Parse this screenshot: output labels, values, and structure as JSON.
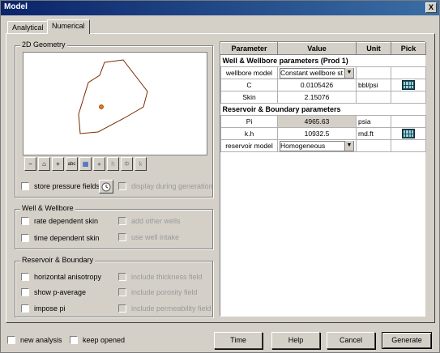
{
  "window": {
    "title": "Model",
    "close_label": "X"
  },
  "tabs": [
    {
      "label": "Analytical"
    },
    {
      "label": "Numerical"
    }
  ],
  "geometry": {
    "title": "2D Geometry",
    "tools": [
      {
        "label": "−",
        "icon": "zoom-out-icon"
      },
      {
        "label": "⌂",
        "icon": "home-icon"
      },
      {
        "label": "+",
        "icon": "zoom-in-icon"
      },
      {
        "label": "abc",
        "icon": "labels-icon"
      },
      {
        "label": "▦",
        "icon": "grid-icon"
      },
      {
        "label": "●",
        "icon": "shape-icon"
      },
      {
        "label": "h",
        "icon": "h-icon"
      },
      {
        "label": "Φ",
        "icon": "phi-icon"
      },
      {
        "label": "k",
        "icon": "k-icon"
      }
    ],
    "store_pressure_label": "store pressure fields",
    "display_during_label": "display during generation"
  },
  "well_group": {
    "title": "Well & Wellbore",
    "rate_dependent_skin": "rate dependent skin",
    "time_dependent_skin": "time dependent skin",
    "add_other_wells": "add other wells",
    "use_well_intake": "use well intake"
  },
  "reservoir_group": {
    "title": "Reservoir & Boundary",
    "horizontal_anisotropy": "horizontal anisotropy",
    "show_p_average": "show p-average",
    "impose_pi": "impose pi",
    "include_thickness": "include thickness field",
    "include_porosity": "include porosity field",
    "include_permeability": "include permeability field"
  },
  "table": {
    "headers": {
      "parameter": "Parameter",
      "value": "Value",
      "unit": "Unit",
      "pick": "Pick"
    },
    "section_well": "Well & Wellbore parameters (Prod 1)",
    "wellbore_model": {
      "param": "wellbore model",
      "value": "Constant wellbore st"
    },
    "c": {
      "param": "C",
      "value": "0.0105426",
      "unit": "bbl/psi"
    },
    "skin": {
      "param": "Skin",
      "value": "2.15076"
    },
    "section_reservoir": "Reservoir & Boundary parameters",
    "pi": {
      "param": "Pi",
      "value": "4965.63",
      "unit": "psia"
    },
    "kh": {
      "param": "k.h",
      "value": "10932.5",
      "unit": "md.ft"
    },
    "reservoir_model": {
      "param": "reservoir model",
      "value": "Homogeneous"
    }
  },
  "bottom": {
    "new_analysis": "new analysis",
    "keep_opened": "keep opened",
    "time": "Time",
    "help": "Help",
    "cancel": "Cancel",
    "generate": "Generate"
  }
}
